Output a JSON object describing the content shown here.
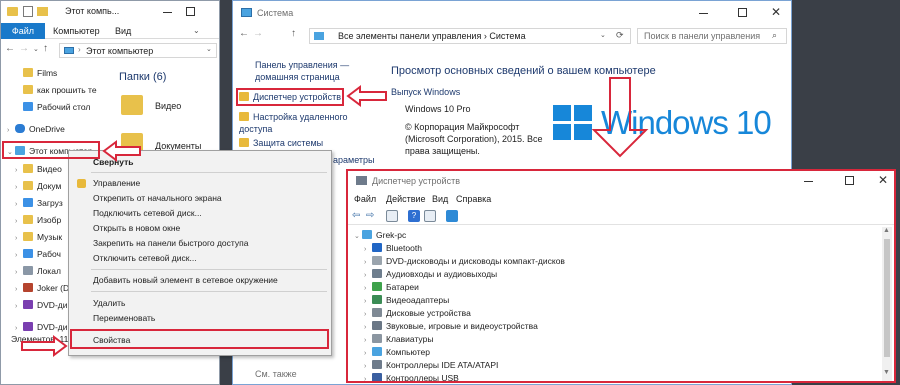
{
  "explorer": {
    "title": "Этот компь...",
    "ribbon_tabs": [
      "Файл",
      "Компьютер",
      "Вид"
    ],
    "address": "Этот компьютер",
    "folders_header": "Папки (6)",
    "folders": [
      "Видео",
      "Документы"
    ],
    "nav_items": [
      {
        "label": "Films",
        "icon": "folder-icon"
      },
      {
        "label": "как прошить те",
        "icon": "folder-icon"
      },
      {
        "label": "Рабочий стол",
        "icon": "desktop-folder-icon"
      },
      {
        "label": "OneDrive",
        "icon": "cloud-icon"
      },
      {
        "label": "Этот компьютер",
        "icon": "computer-icon"
      },
      {
        "label": "Видео",
        "icon": "video-folder-icon"
      },
      {
        "label": "Докум",
        "icon": "documents-folder-icon"
      },
      {
        "label": "Загруз",
        "icon": "downloads-folder-icon"
      },
      {
        "label": "Изобр",
        "icon": "pictures-folder-icon"
      },
      {
        "label": "Музык",
        "icon": "music-folder-icon"
      },
      {
        "label": "Рабоч",
        "icon": "desktop-folder-icon"
      },
      {
        "label": "Локал",
        "icon": "drive-icon"
      },
      {
        "label": "Joker (D",
        "icon": "drive-icon"
      },
      {
        "label": "DVD-ди",
        "icon": "dvd-icon"
      },
      {
        "label": "DVD-ди",
        "icon": "dvd-icon"
      }
    ],
    "status": "Элементов: 11"
  },
  "context_menu": {
    "items": [
      {
        "label": "Свернуть",
        "bold": true
      },
      {
        "separator": true
      },
      {
        "label": "Управление",
        "icon": "shield-icon"
      },
      {
        "label": "Открепить от начального экрана"
      },
      {
        "label": "Подключить сетевой диск..."
      },
      {
        "label": "Открыть в новом окне"
      },
      {
        "label": "Закрепить на панели быстрого доступа"
      },
      {
        "label": "Отключить сетевой диск..."
      },
      {
        "separator": true
      },
      {
        "label": "Добавить новый элемент в сетевое окружение"
      },
      {
        "separator": true
      },
      {
        "label": "Удалить"
      },
      {
        "label": "Переименовать"
      },
      {
        "separator": true
      },
      {
        "label": "Свойства",
        "highlight": true
      }
    ]
  },
  "system": {
    "title": "Система",
    "address": "Все элементы панели управления  ›  Система",
    "search_placeholder": "Поиск в панели управления",
    "sidebar": {
      "home": "Панель управления — домашняя страница",
      "links": [
        {
          "label": "Диспетчер устройств",
          "icon": "shield-icon",
          "highlight": true
        },
        {
          "label": "Настройка удаленного доступа",
          "icon": "shield-icon"
        },
        {
          "label": "Защита системы",
          "icon": "shield-icon"
        },
        {
          "label": "араметры",
          "icon": ""
        }
      ],
      "see_also": "См. также"
    },
    "heading": "Просмотр основных сведений о вашем компьютере",
    "edition_title": "Выпуск Windows",
    "edition": "Windows 10 Pro",
    "copyright": "© Корпорация Майкрософт (Microsoft Corporation), 2015. Все права защищены.",
    "logo_text": "Windows 10",
    "colors": {
      "logo": "#1787d9"
    }
  },
  "device_manager": {
    "title": "Диспетчер устройств",
    "menu": [
      "Файл",
      "Действие",
      "Вид",
      "Справка"
    ],
    "root": "Grek-pc",
    "devices": [
      {
        "label": "Bluetooth",
        "icon": "bluetooth-icon"
      },
      {
        "label": "DVD-дисководы и дисководы компакт-дисков",
        "icon": "dvd-icon"
      },
      {
        "label": "Аудиовходы и аудиовыходы",
        "icon": "audio-icon"
      },
      {
        "label": "Батареи",
        "icon": "battery-icon"
      },
      {
        "label": "Видеоадаптеры",
        "icon": "display-adapter-icon"
      },
      {
        "label": "Дисковые устройства",
        "icon": "disk-icon"
      },
      {
        "label": "Звуковые, игровые и видеоустройства",
        "icon": "sound-icon"
      },
      {
        "label": "Клавиатуры",
        "icon": "keyboard-icon"
      },
      {
        "label": "Компьютер",
        "icon": "computer-icon"
      },
      {
        "label": "Контроллеры IDE ATA/ATAPI",
        "icon": "ide-icon"
      },
      {
        "label": "Контроллеры USB",
        "icon": "usb-icon"
      }
    ]
  },
  "accent": {
    "highlight_red": "#d8273b",
    "ribbon_blue": "#1979ca"
  }
}
